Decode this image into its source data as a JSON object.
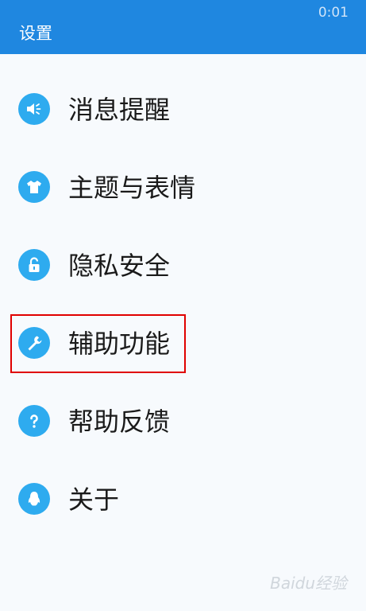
{
  "status_bar": {
    "time": "0:01"
  },
  "header": {
    "title": "设置"
  },
  "menu": {
    "items": [
      {
        "label": "消息提醒",
        "icon": "speaker-icon"
      },
      {
        "label": "主题与表情",
        "icon": "shirt-icon"
      },
      {
        "label": "隐私安全",
        "icon": "lock-icon"
      },
      {
        "label": "辅助功能",
        "icon": "wrench-icon",
        "highlighted": true
      },
      {
        "label": "帮助反馈",
        "icon": "question-icon"
      },
      {
        "label": "关于",
        "icon": "penguin-icon"
      }
    ]
  },
  "colors": {
    "header": "#1f87e0",
    "icon_bg": "#2eabef",
    "highlight_border": "#e00000",
    "background": "#f7fafd"
  },
  "watermark": "Baidu经验"
}
